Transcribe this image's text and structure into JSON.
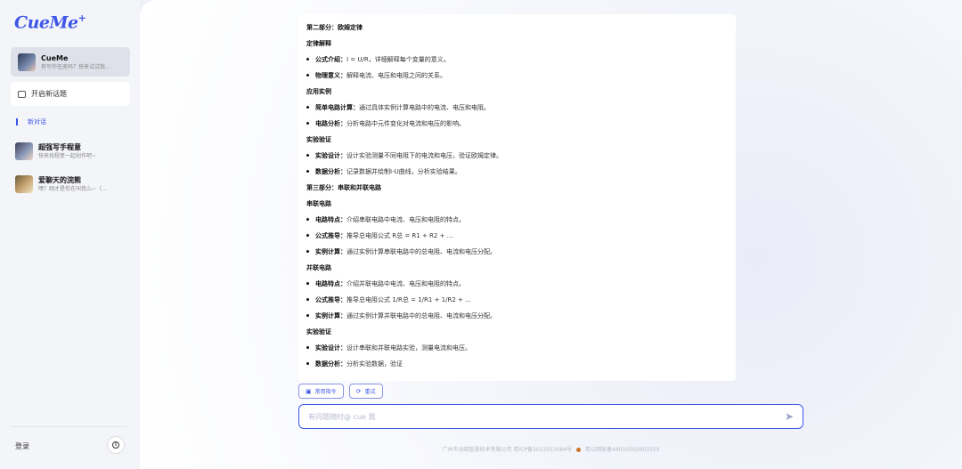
{
  "sidebar": {
    "logo": "CueMe",
    "logo_mark": "+",
    "active_bot": {
      "name": "CueMe",
      "desc": "有写作任务吗？快来试试我…"
    },
    "new_topic_label": "开启新话题",
    "new_chat_label": "新对话",
    "conversations": [
      {
        "title": "超强写手程意",
        "desc": "快来找程意一起创作吧~"
      },
      {
        "title": "爱聊天的浣熊",
        "desc": "嘿？刚才是你在叫我么~（…"
      }
    ],
    "login_label": "登录",
    "info_icon": "info-icon"
  },
  "content": {
    "part2_title": "第二部分：欧姆定律",
    "s1_title": "定律解释",
    "s1_items": [
      {
        "bold": "公式介绍：",
        "text": "I = U/R，详细解释每个变量的意义。"
      },
      {
        "bold": "物理意义：",
        "text": "解释电流、电压和电阻之间的关系。"
      }
    ],
    "s2_title": "应用实例",
    "s2_items": [
      {
        "bold": "简单电路计算：",
        "text": "通过具体实例计算电路中的电流、电压和电阻。"
      },
      {
        "bold": "电路分析：",
        "text": "分析电路中元件变化对电流和电压的影响。"
      }
    ],
    "s3_title": "实验验证",
    "s3_items": [
      {
        "bold": "实验设计：",
        "text": "设计实验测量不同电阻下的电流和电压，验证欧姆定律。"
      },
      {
        "bold": "数据分析：",
        "text": "记录数据并绘制I-U曲线，分析实验结果。"
      }
    ],
    "part3_title": "第三部分：串联和并联电路",
    "s4_title": "串联电路",
    "s4_items": [
      {
        "bold": "电路特点：",
        "text": "介绍串联电路中电流、电压和电阻的特点。"
      },
      {
        "bold": "公式推导：",
        "text": "推导总电阻公式 R总 = R1 + R2 + ..."
      },
      {
        "bold": "实例计算：",
        "text": "通过实例计算串联电路中的总电阻、电流和电压分配。"
      }
    ],
    "s5_title": "并联电路",
    "s5_items": [
      {
        "bold": "电路特点：",
        "text": "介绍并联电路中电流、电压和电阻的特点。"
      },
      {
        "bold": "公式推导：",
        "text": "推导总电阻公式 1/R总 = 1/R1 + 1/R2 + ..."
      },
      {
        "bold": "实例计算：",
        "text": "通过实例计算并联电路中的总电阻、电流和电压分配。"
      }
    ],
    "s6_title": "实验验证",
    "s6_items": [
      {
        "bold": "实验设计：",
        "text": "设计串联和并联电路实验，测量电流和电压。"
      },
      {
        "bold": "数据分析：",
        "text": "分析实验数据，验证"
      }
    ]
  },
  "actions": {
    "commands_label": "常用指令",
    "retry_label": "重试"
  },
  "input": {
    "placeholder": "有问题随时@ cue 我"
  },
  "footer": {
    "icp": "广州市动晓智慧技术有限公司 粤ICP备2022013084号",
    "police": "粤公网安备44010502003355"
  },
  "colors": {
    "accent": "#3d56e8"
  }
}
